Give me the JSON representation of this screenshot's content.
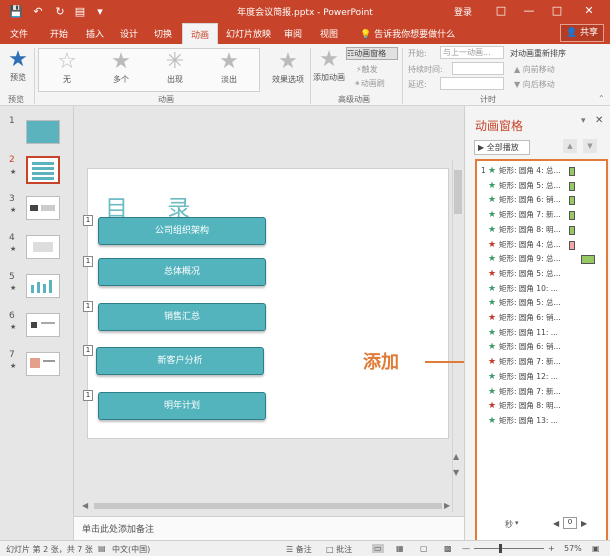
{
  "window": {
    "title": "年度会议简报.pptx - PowerPoint",
    "login": "登录",
    "share": "共享"
  },
  "tabs": [
    {
      "label": "文件"
    },
    {
      "label": "开始"
    },
    {
      "label": "插入"
    },
    {
      "label": "设计"
    },
    {
      "label": "切换"
    },
    {
      "label": "动画"
    },
    {
      "label": "幻灯片放映"
    },
    {
      "label": "审阅"
    },
    {
      "label": "视图"
    }
  ],
  "tellme": "告诉我你想要做什么",
  "ribbon": {
    "preview": "预览",
    "preview_group": "预览",
    "animations": [
      "无",
      "多个",
      "出现",
      "淡出"
    ],
    "effects": "效果选项",
    "anim_group": "动画",
    "add_anim": "添加动画",
    "anim_pane": "动画窗格",
    "trigger": "触发",
    "painter": "动画刷",
    "adv_group": "高级动画",
    "start_label": "开始:",
    "start_value": "与上一动画...",
    "duration": "持续时间:",
    "delay": "延迟:",
    "timing_group": "计时",
    "reorder": "对动画重新排序",
    "move_earlier": "向前移动",
    "move_later": "向后移动"
  },
  "slides": [
    {
      "num": "1"
    },
    {
      "num": "2"
    },
    {
      "num": "3"
    },
    {
      "num": "4"
    },
    {
      "num": "5"
    },
    {
      "num": "6"
    },
    {
      "num": "7"
    }
  ],
  "slide": {
    "title": "目 录",
    "boxes": [
      "公司组织架构",
      "总体概况",
      "销售汇总",
      "新客户分析",
      "明年计划"
    ],
    "tags": [
      "1",
      "1",
      "1",
      "1",
      "1"
    ]
  },
  "notes": "单击此处添加备注",
  "anim_pane": {
    "title": "动画窗格",
    "play_all": "全部播放",
    "first_num": "1",
    "items": [
      {
        "label": "矩形: 圆角 4: 总...",
        "color": "green",
        "bar": "#96c864",
        "barw": 6
      },
      {
        "label": "矩形: 圆角 5: 总...",
        "color": "green",
        "bar": "#96c864",
        "barw": 6
      },
      {
        "label": "矩形: 圆角 6: 销...",
        "color": "green",
        "bar": "#96c864",
        "barw": 6
      },
      {
        "label": "矩形: 圆角 7: 新...",
        "color": "green",
        "bar": "#96c864",
        "barw": 6
      },
      {
        "label": "矩形: 圆角 8: 明...",
        "color": "green",
        "bar": "#96c864",
        "barw": 6
      },
      {
        "label": "矩形: 圆角 4: 总...",
        "color": "red",
        "bar": "#f4a6a6",
        "barw": 6
      },
      {
        "label": "矩形: 圆角 9: 总...",
        "color": "green",
        "bar": "#96c864",
        "barw": 14
      },
      {
        "label": "矩形: 圆角 5: 总...",
        "color": "red",
        "bar": "",
        "barw": 0
      },
      {
        "label": "矩形: 圆角 10: ...",
        "color": "green",
        "bar": "",
        "barw": 0
      },
      {
        "label": "矩形: 圆角 5: 总...",
        "color": "green",
        "bar": "",
        "barw": 0
      },
      {
        "label": "矩形: 圆角 6: 销...",
        "color": "red",
        "bar": "",
        "barw": 0
      },
      {
        "label": "矩形: 圆角 11: ...",
        "color": "green",
        "bar": "",
        "barw": 0
      },
      {
        "label": "矩形: 圆角 6: 销...",
        "color": "green",
        "bar": "",
        "barw": 0
      },
      {
        "label": "矩形: 圆角 7: 新...",
        "color": "red",
        "bar": "",
        "barw": 0
      },
      {
        "label": "矩形: 圆角 12: ...",
        "color": "green",
        "bar": "",
        "barw": 0
      },
      {
        "label": "矩形: 圆角 7: 新...",
        "color": "green",
        "bar": "",
        "barw": 0
      },
      {
        "label": "矩形: 圆角 8: 明...",
        "color": "red",
        "bar": "",
        "barw": 0
      },
      {
        "label": "矩形: 圆角 13: ...",
        "color": "green",
        "bar": "",
        "barw": 0
      }
    ],
    "seconds": "秒",
    "zoom_box": "0"
  },
  "annotation": "添加",
  "status": {
    "slide_info": "幻灯片 第 2 张，共 7 张",
    "lang": "中文(中国)",
    "notes": "备注",
    "comments": "批注",
    "zoom": "57%"
  },
  "colors": {
    "accent": "#c7442a",
    "star_green": "#3a9a6a",
    "star_red": "#c0392b",
    "highlight": "#e07b39"
  }
}
